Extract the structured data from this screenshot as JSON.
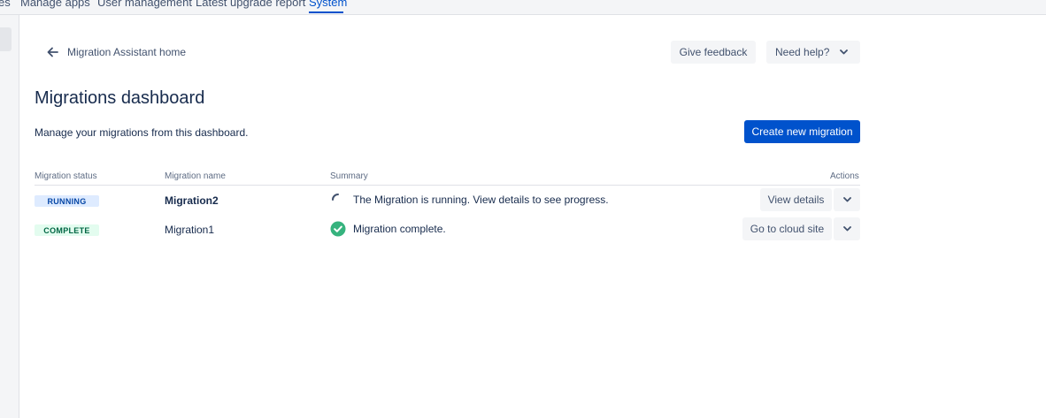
{
  "topnav": {
    "tabs": [
      {
        "label": "es"
      },
      {
        "label": "Manage apps"
      },
      {
        "label": "User management"
      },
      {
        "label": "Latest upgrade report"
      },
      {
        "label": "System"
      }
    ],
    "active_tab": "System"
  },
  "header": {
    "back_label": "Migration Assistant home",
    "feedback_label": "Give feedback",
    "help_label": "Need help?"
  },
  "page": {
    "title": "Migrations dashboard",
    "description": "Manage your migrations from this dashboard.",
    "create_label": "Create new migration"
  },
  "table": {
    "columns": {
      "status": "Migration status",
      "name": "Migration name",
      "summary": "Summary",
      "actions": "Actions"
    },
    "rows": [
      {
        "status": "RUNNING",
        "name": "Migration2",
        "summary": "The Migration is running. View details to see progress.",
        "summary_icon": "spinner-icon",
        "action_label": "View details"
      },
      {
        "status": "COMPLETE",
        "name": "Migration1",
        "summary": "Migration complete.",
        "summary_icon": "check-circle-icon",
        "action_label": "Go to cloud site"
      }
    ]
  },
  "colors": {
    "primary": "#0052CC",
    "running_bg": "#DEEBFF",
    "running_text": "#0747A6",
    "complete_bg": "#E3FCEF",
    "complete_text": "#006644",
    "success_icon": "#36B37E"
  }
}
